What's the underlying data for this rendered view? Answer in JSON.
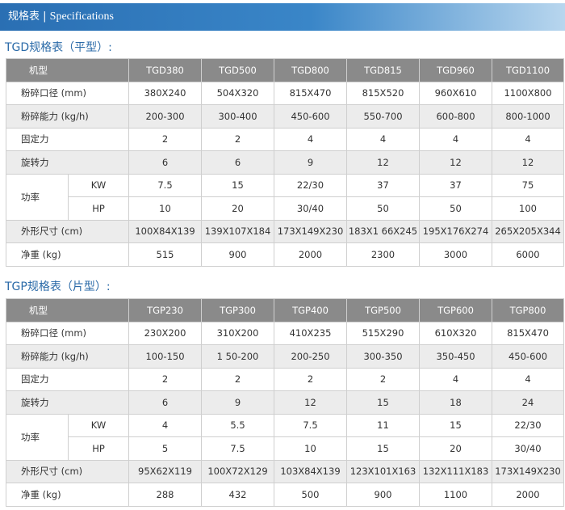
{
  "header": {
    "title_cn": "规格表",
    "separator": " | ",
    "title_en": "Specifications"
  },
  "tgd": {
    "title": "TGD规格表（平型）:",
    "header_label": "机型",
    "models": [
      "TGD380",
      "TGD500",
      "TGD800",
      "TGD815",
      "TGD960",
      "TGD1100"
    ],
    "rows": {
      "opening": {
        "label": "粉碎口径 (mm)",
        "values": [
          "380X240",
          "504X320",
          "815X470",
          "815X520",
          "960X610",
          "1100X800"
        ]
      },
      "capacity": {
        "label": "粉碎能力 (kg/h)",
        "values": [
          "200-300",
          "300-400",
          "450-600",
          "550-700",
          "600-800",
          "800-1000"
        ]
      },
      "fixed": {
        "label": "固定力",
        "values": [
          "2",
          "2",
          "4",
          "4",
          "4",
          "4"
        ]
      },
      "rotary": {
        "label": "旋转力",
        "values": [
          "6",
          "6",
          "9",
          "12",
          "12",
          "12"
        ]
      },
      "power_label": "功率",
      "kw": {
        "label": "KW",
        "values": [
          "7.5",
          "15",
          "22/30",
          "37",
          "37",
          "75"
        ]
      },
      "hp": {
        "label": "HP",
        "values": [
          "10",
          "20",
          "30/40",
          "50",
          "50",
          "100"
        ]
      },
      "dims": {
        "label": "外形尺寸 (cm)",
        "values": [
          "100X84X139",
          "139X107X184",
          "173X149X230",
          "183X1 66X245",
          "195X176X274",
          "265X205X344"
        ]
      },
      "weight": {
        "label": "净重 (kg)",
        "values": [
          "515",
          "900",
          "2000",
          "2300",
          "3000",
          "6000"
        ]
      }
    }
  },
  "tgp": {
    "title": "TGP规格表（片型）:",
    "header_label": "机型",
    "models": [
      "TGP230",
      "TGP300",
      "TGP400",
      "TGP500",
      "TGP600",
      "TGP800"
    ],
    "rows": {
      "opening": {
        "label": "粉碎口径 (mm)",
        "values": [
          "230X200",
          "310X200",
          "410X235",
          "515X290",
          "610X320",
          "815X470"
        ]
      },
      "capacity": {
        "label": "粉碎能力 (kg/h)",
        "values": [
          "100-150",
          "1 50-200",
          "200-250",
          "300-350",
          "350-450",
          "450-600"
        ]
      },
      "fixed": {
        "label": "固定力",
        "values": [
          "2",
          "2",
          "2",
          "2",
          "4",
          "4"
        ]
      },
      "rotary": {
        "label": "旋转力",
        "values": [
          "6",
          "9",
          "12",
          "15",
          "18",
          "24"
        ]
      },
      "power_label": "功率",
      "kw": {
        "label": "KW",
        "values": [
          "4",
          "5.5",
          "7.5",
          "11",
          "15",
          "22/30"
        ]
      },
      "hp": {
        "label": "HP",
        "values": [
          "5",
          "7.5",
          "10",
          "15",
          "20",
          "30/40"
        ]
      },
      "dims": {
        "label": "外形尺寸 (cm)",
        "values": [
          "95X62X119",
          "100X72X129",
          "103X84X139",
          "123X101X163",
          "132X111X183",
          "173X149X230"
        ]
      },
      "weight": {
        "label": "净重 (kg)",
        "values": [
          "288",
          "432",
          "500",
          "900",
          "1100",
          "2000"
        ]
      }
    }
  },
  "colors": {
    "header_blue": "#2a6fb3",
    "title_blue": "#2a6aa8",
    "table_header_gray": "#8a8a8a",
    "row_shade": "#ececec"
  }
}
